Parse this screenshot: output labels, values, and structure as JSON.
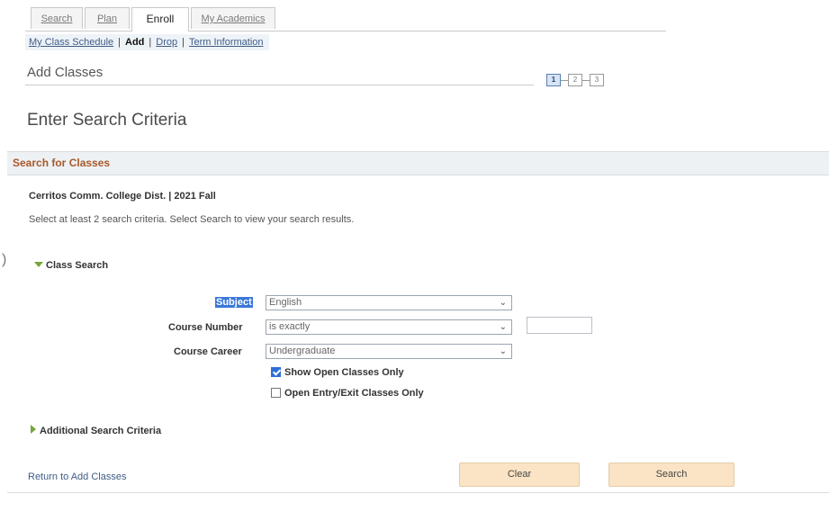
{
  "tabs": [
    {
      "label": "Search",
      "active": false
    },
    {
      "label": "Plan",
      "active": false
    },
    {
      "label": "Enroll",
      "active": true
    },
    {
      "label": "My Academics",
      "active": false
    }
  ],
  "subnav": {
    "items": [
      "My Class Schedule",
      "Add",
      "Drop",
      "Term Information"
    ],
    "current": "Add",
    "separator": "|"
  },
  "page": {
    "title": "Add Classes",
    "steps": [
      "1",
      "2",
      "3"
    ],
    "current_step": "1",
    "section_title": "Enter Search Criteria"
  },
  "search_box": {
    "header": "Search for Classes",
    "institution_term": "Cerritos Comm. College Dist. | 2021 Fall",
    "instructions": "Select at least 2 search criteria. Select Search to view your search results.",
    "class_search_label": "Class Search",
    "fields": {
      "subject": {
        "label": "Subject",
        "value": "English"
      },
      "course_number": {
        "label": "Course Number",
        "operator": "is exactly",
        "value": ""
      },
      "course_career": {
        "label": "Course Career",
        "value": "Undergraduate"
      }
    },
    "checkboxes": {
      "show_open": {
        "label": "Show Open Classes Only",
        "checked": true
      },
      "open_entry": {
        "label": "Open Entry/Exit Classes Only",
        "checked": false
      }
    },
    "additional_label": "Additional Search Criteria"
  },
  "footer": {
    "return_link": "Return to Add Classes",
    "clear_label": "Clear",
    "search_label": "Search"
  },
  "colors": {
    "section_header_text": "#a8582b",
    "link": "#3f5c86",
    "button_bg": "#fbe4c5",
    "expand_icon": "#74a63a",
    "checkbox_checked": "#2d6fd3"
  },
  "icons": {
    "collapse": "triangle-down-icon",
    "expand": "triangle-right-icon",
    "dropdown": "chevron-down-icon",
    "checkbox": "checkmark-icon"
  }
}
